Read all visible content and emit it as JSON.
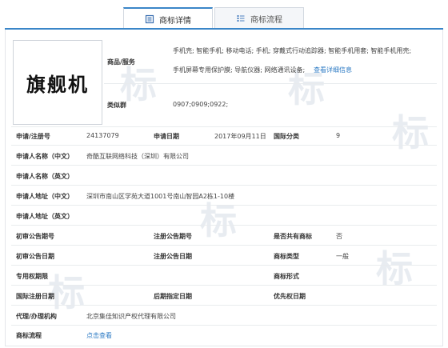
{
  "tabs": [
    {
      "label": "商标详情",
      "icon": "document-list-icon"
    },
    {
      "label": "商标流程",
      "icon": "flow-list-icon"
    }
  ],
  "mark_text": "旗舰机",
  "goods": {
    "label": "商品/服务",
    "line1": "手机壳; 智能手机; 移动电话; 手机; 穿戴式行动追踪器; 智能手机用套; 智能手机用壳;",
    "line2": "手机屏幕专用保护膜; 导航仪器; 网络通讯设备;",
    "more_link": "查看详细信息"
  },
  "similar_group": {
    "label": "类似群",
    "value": "0907;0909;0922;"
  },
  "fields": {
    "reg_no_label": "申请/注册号",
    "reg_no": "24137079",
    "app_date_label": "申请日期",
    "app_date": "2017年09月11日",
    "intl_class_label": "国际分类",
    "intl_class": "9",
    "applicant_cn_label": "申请人名称（中文）",
    "applicant_cn": "奇酷互联网络科技（深圳）有限公司",
    "applicant_en_label": "申请人名称（英文）",
    "applicant_en": "",
    "address_cn_label": "申请人地址（中文）",
    "address_cn": "深圳市南山区学苑大道1001号南山智园A2栋1-10楼",
    "address_en_label": "申请人地址（英文）",
    "address_en": "",
    "prelim_no_label": "初审公告期号",
    "prelim_no": "",
    "reg_ann_no_label": "注册公告期号",
    "reg_ann_no": "",
    "shared_label": "是否共有商标",
    "shared": "否",
    "prelim_date_label": "初审公告日期",
    "prelim_date": "",
    "reg_ann_date_label": "注册公告日期",
    "reg_ann_date": "",
    "mark_type_label": "商标类型",
    "mark_type": "一般",
    "exclusive_label": "专用权期限",
    "exclusive": "",
    "mark_form_label": "商标形式",
    "mark_form": "",
    "intl_reg_date_label": "国际注册日期",
    "intl_reg_date": "",
    "later_date_label": "后期指定日期",
    "later_date": "",
    "priority_date_label": "优先权日期",
    "priority_date": "",
    "agent_label": "代理/办理机构",
    "agent": "北京集佳知识产权代理有限公司",
    "process_label": "商标流程",
    "process_link": "点击查看"
  },
  "watermark": "标"
}
